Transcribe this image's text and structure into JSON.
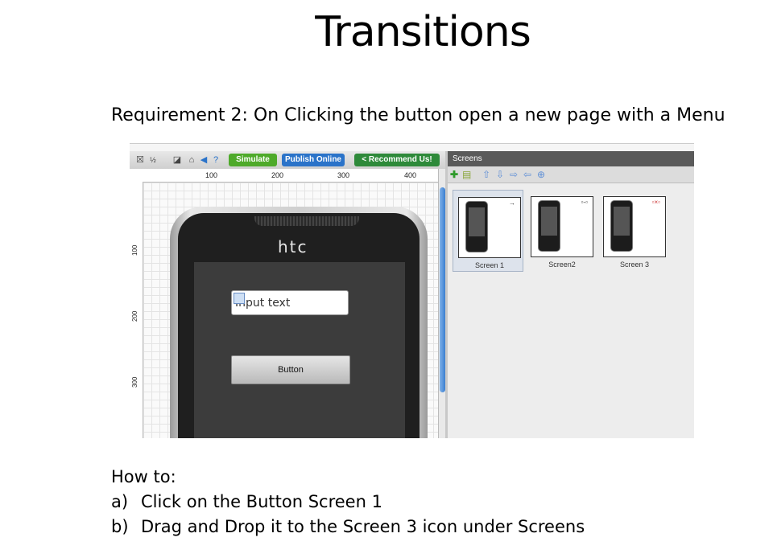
{
  "slide": {
    "title": "Transitions",
    "requirement": "Requirement 2: On Clicking the button open a new page with a Menu",
    "howto_heading": "How to:",
    "steps": [
      {
        "marker": "a)",
        "text": "Click on the Button Screen 1"
      },
      {
        "marker": "b)",
        "text": "Drag and Drop it to the Screen 3 icon under Screens"
      }
    ]
  },
  "toolbar": {
    "zoom_label": "½",
    "simulate_label": "Simulate",
    "publish_label": "Publish Online",
    "recommend_label": "Recommend Us!"
  },
  "ruler": {
    "top_ticks": [
      "100",
      "200",
      "300",
      "400"
    ],
    "left_ticks": [
      "100",
      "200",
      "300"
    ]
  },
  "phone": {
    "brand": "htc",
    "input_placeholder": "Input text",
    "button_label": "Button"
  },
  "screens": {
    "header": "Screens",
    "items": [
      {
        "label": "Screen 1",
        "mark": "→",
        "selected": true
      },
      {
        "label": "Screen2",
        "mark": "▫‐▫",
        "selected": false
      },
      {
        "label": "Screen 3",
        "mark": "▫×▫",
        "selected": false
      }
    ]
  },
  "colors": {
    "simulate": "#4eaa2a",
    "publish": "#2a73c9",
    "recommend": "#2e8a3a",
    "screens_header": "#5a5a5a"
  }
}
